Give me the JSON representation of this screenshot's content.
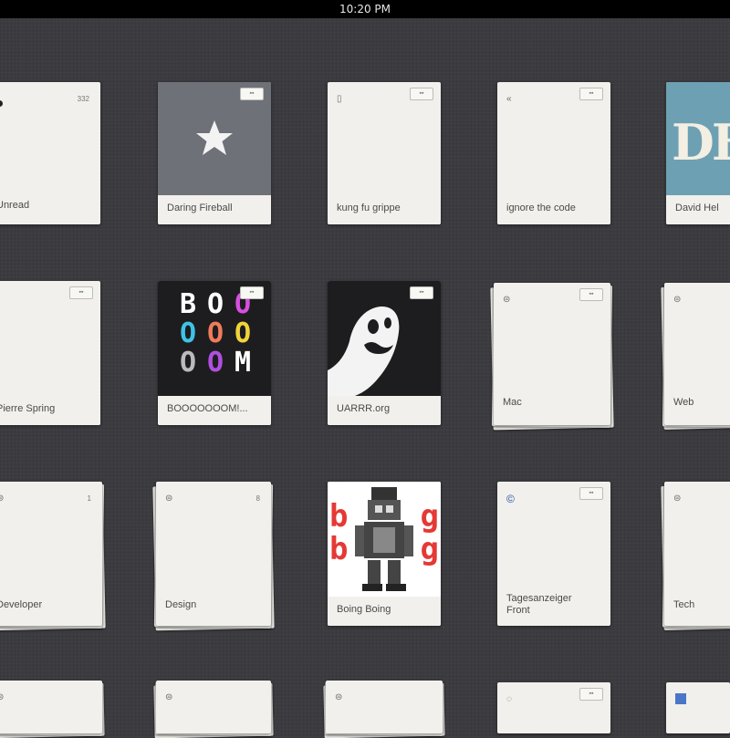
{
  "status_bar": {
    "time": "10:20 PM"
  },
  "colors": {
    "background": "#3b3b40",
    "card": "#f1f0ec",
    "star_thumb": "#6f7178",
    "dh_teal": "#6ea0b3",
    "boing_red": "#e53935"
  },
  "feeds": {
    "unread": {
      "label": "Unread",
      "icon": "unread-dot-icon",
      "count": "332"
    },
    "daring_fireball": {
      "label": "Daring Fireball",
      "icon": "star-icon"
    },
    "kung_fu": {
      "label": "kung fu grippe",
      "icon": "feed-icon"
    },
    "ignore": {
      "label": "ignore the code",
      "icon": "rewind-icon"
    },
    "david": {
      "label": "David Hel",
      "thumb_text": "DH"
    },
    "pierre": {
      "label": "Pierre Spring",
      "icon": "rss-icon"
    },
    "boooooom": {
      "label": "BOOOOOOOM!...",
      "thumb_text": [
        "B",
        "O",
        "O",
        "O",
        "O",
        "O",
        "O",
        "O",
        "M"
      ]
    },
    "uarrr": {
      "label": "UARRR.org",
      "icon": "ghost-icon"
    },
    "mac": {
      "label": "Mac",
      "icon": "folder-icon"
    },
    "web": {
      "label": "Web",
      "icon": "folder-icon"
    },
    "developer": {
      "label": "Developer",
      "icon": "folder-icon",
      "count": "1"
    },
    "design": {
      "label": "Design",
      "icon": "folder-icon",
      "count": "8"
    },
    "boing": {
      "label": "Boing Boing",
      "icon": "robot-icon",
      "thumb_text": [
        "b",
        "g",
        "b",
        "g"
      ]
    },
    "tages": {
      "label": "Tagesanzeiger\nFront",
      "icon": "copyright-icon"
    },
    "tech": {
      "label": "Tech",
      "icon": "folder-icon"
    }
  }
}
